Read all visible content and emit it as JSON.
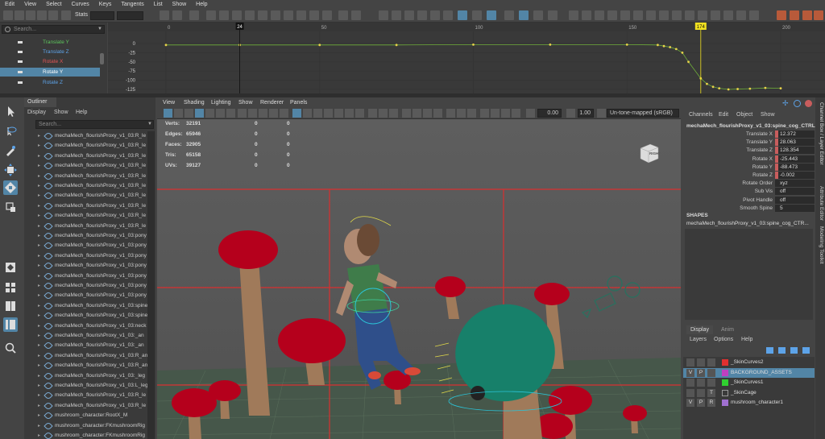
{
  "menubar": [
    "Edit",
    "View",
    "Select",
    "Curves",
    "Keys",
    "Tangents",
    "List",
    "Show",
    "Help"
  ],
  "toolbar": {
    "stats_label": "Stats"
  },
  "graph_editor": {
    "search_placeholder": "Search...",
    "channels": [
      {
        "label": "Translate Y",
        "color": "#5cc55c"
      },
      {
        "label": "Translate Z",
        "color": "#5da3e8"
      },
      {
        "label": "Rotate X",
        "color": "#e05555"
      },
      {
        "label": "Rotate Y",
        "color": "#ffffff",
        "selected": true
      },
      {
        "label": "Rotate Z",
        "color": "#5da3e8"
      }
    ],
    "frame_ticks": [
      "0",
      "50",
      "100",
      "150",
      "200"
    ],
    "current_frame_left": "24",
    "current_frame_right": "174",
    "value_ticks": [
      "0",
      "-25",
      "-50",
      "-75",
      "-100",
      "-125",
      "-150"
    ]
  },
  "outliner": {
    "tab": "Outliner",
    "menu": [
      "Display",
      "Show",
      "Help"
    ],
    "search_placeholder": "Search...",
    "items": [
      "mechaMech_flourishProxy_v1_03:R_le",
      "mechaMech_flourishProxy_v1_03:R_le",
      "mechaMech_flourishProxy_v1_03:R_le",
      "mechaMech_flourishProxy_v1_03:R_le",
      "mechaMech_flourishProxy_v1_03:R_le",
      "mechaMech_flourishProxy_v1_03:R_le",
      "mechaMech_flourishProxy_v1_03:R_le",
      "mechaMech_flourishProxy_v1_03:R_le",
      "mechaMech_flourishProxy_v1_03:R_le",
      "mechaMech_flourishProxy_v1_03:R_le",
      "mechaMech_flourishProxy_v1_03:pony",
      "mechaMech_flourishProxy_v1_03:pony",
      "mechaMech_flourishProxy_v1_03:pony",
      "mechaMech_flourishProxy_v1_03:pony",
      "mechaMech_flourishProxy_v1_03:pony",
      "mechaMech_flourishProxy_v1_03:pony",
      "mechaMech_flourishProxy_v1_03:pony",
      "mechaMech_flourishProxy_v1_03:spine",
      "mechaMech_flourishProxy_v1_03:spine",
      "mechaMech_flourishProxy_v1_03:neck",
      "mechaMech_flourishProxy_v1_03:_an",
      "mechaMech_flourishProxy_v1_03:_an",
      "mechaMech_flourishProxy_v1_03:R_an",
      "mechaMech_flourishProxy_v1_03:R_an",
      "mechaMech_flourishProxy_v1_03:_leg",
      "mechaMech_flourishProxy_v1_03:L_leg",
      "mechaMech_flourishProxy_v1_03:R_le",
      "mechaMech_flourishProxy_v1_03:R_le",
      "mushroom_character:RootX_M",
      "mushroom_character:FKmushroomRig",
      "mushroom_character:FKmushroomRig"
    ]
  },
  "viewport": {
    "menu": [
      "View",
      "Shading",
      "Lighting",
      "Show",
      "Renderer",
      "Panels"
    ],
    "field1": "0.00",
    "field2": "1.00",
    "colorspace": "Un-tone-mapped (sRGB)",
    "viewcube_label": "RIGHT",
    "hud": [
      {
        "label": "Verts:",
        "v1": "32191",
        "v2": "0",
        "v3": "0"
      },
      {
        "label": "Edges:",
        "v1": "65946",
        "v2": "0",
        "v3": "0"
      },
      {
        "label": "Faces:",
        "v1": "32905",
        "v2": "0",
        "v3": "0"
      },
      {
        "label": "Tris:",
        "v1": "65158",
        "v2": "0",
        "v3": "0"
      },
      {
        "label": "UVs:",
        "v1": "39127",
        "v2": "0",
        "v3": "0"
      }
    ]
  },
  "channel_box": {
    "menu": [
      "Channels",
      "Edit",
      "Object",
      "Show"
    ],
    "node": "mechaMech_flourishProxy_v1_03:spine_cog_CTRL",
    "attributes": [
      {
        "name": "Translate X",
        "value": "12.372",
        "keyed": true
      },
      {
        "name": "Translate Y",
        "value": "28.063",
        "keyed": true
      },
      {
        "name": "Translate Z",
        "value": "128.354",
        "keyed": true
      },
      {
        "name": "Rotate X",
        "value": "-25.443",
        "keyed": true
      },
      {
        "name": "Rotate Y",
        "value": "-88.473",
        "keyed": true
      },
      {
        "name": "Rotate Z",
        "value": "-0.002",
        "keyed": true
      },
      {
        "name": "Rotate Order",
        "value": "xyz",
        "keyed": false
      },
      {
        "name": "Sub Vis",
        "value": "off",
        "keyed": false
      },
      {
        "name": "Pivot Handle",
        "value": "off",
        "keyed": false
      },
      {
        "name": "Smooth Spine",
        "value": "5",
        "keyed": false
      }
    ],
    "shapes_label": "SHAPES",
    "shape_node": "mechaMech_flourishProxy_v1_03:spine_cog_CTR..."
  },
  "layers": {
    "tabs": [
      "Display",
      "Anim"
    ],
    "menu": [
      "Layers",
      "Options",
      "Help"
    ],
    "items": [
      {
        "v": "",
        "p": "",
        "r": "",
        "color": "#e03030",
        "name": "_SkinCurves2",
        "selected": false
      },
      {
        "v": "V",
        "p": "P",
        "r": "",
        "color": "#c040c0",
        "name": "BACKGROUND_ASSETS",
        "selected": true
      },
      {
        "v": "",
        "p": "",
        "r": "",
        "color": "#30d030",
        "name": "_SkinCurves1",
        "selected": false
      },
      {
        "v": "",
        "p": "",
        "r": "T",
        "color": "",
        "name": "_SkinCage",
        "selected": false
      },
      {
        "v": "V",
        "p": "P",
        "r": "R",
        "color": "#a070d0",
        "name": "mushroom_character1",
        "selected": false
      }
    ]
  },
  "right_tabs": [
    "Channel Box / Layer Editor",
    "Attribute Editor",
    "Modeling Toolkit"
  ],
  "chart_data": {
    "type": "line",
    "x": [
      0,
      24,
      50,
      75,
      100,
      125,
      150,
      160,
      162,
      164,
      166,
      168,
      170,
      174,
      176,
      178,
      180,
      183,
      186,
      190,
      195,
      200
    ],
    "y": [
      -4,
      -4,
      -4,
      -4,
      -3,
      -3,
      -3,
      -4,
      -7,
      -10,
      -15,
      -25,
      -50,
      -95,
      -110,
      -118,
      -122,
      -125,
      -124,
      -123,
      -121,
      -122
    ],
    "xlim": [
      -5,
      215
    ],
    "ylim": [
      -155,
      15
    ],
    "x_ticks": [
      0,
      50,
      100,
      150,
      200
    ],
    "y_ticks": [
      0,
      -25,
      -50,
      -75,
      -100,
      -125,
      -150
    ],
    "series_color": "#6fae3a"
  }
}
